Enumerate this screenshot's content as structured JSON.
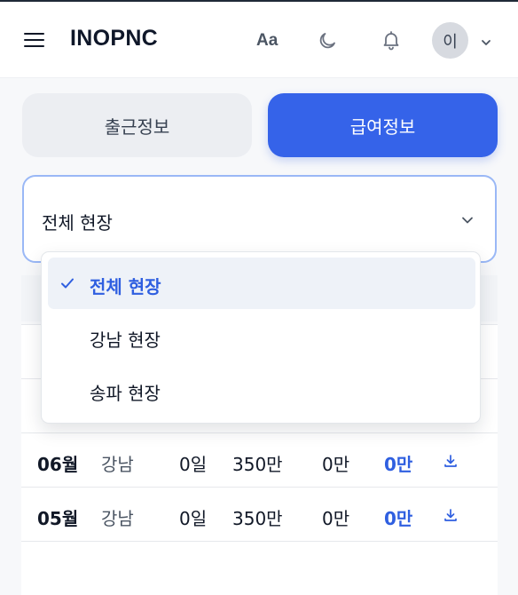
{
  "header": {
    "brand": "INOPNC",
    "font_size_label": "Aa",
    "avatar_initial": "이"
  },
  "tabs": [
    {
      "label": "출근정보",
      "active": false
    },
    {
      "label": "급여정보",
      "active": true
    }
  ],
  "site_select": {
    "value": "전체 현장",
    "options": [
      {
        "label": "전체 현장",
        "selected": true
      },
      {
        "label": "강남 현장",
        "selected": false
      },
      {
        "label": "송파 현장",
        "selected": false
      }
    ]
  },
  "salary_table": {
    "rows": [
      {
        "month": "06월",
        "site": "강남",
        "days": "0일",
        "base": "350만",
        "deduction": "0만",
        "net": "0만"
      },
      {
        "month": "05월",
        "site": "강남",
        "days": "0일",
        "base": "350만",
        "deduction": "0만",
        "net": "0만"
      }
    ]
  },
  "colors": {
    "accent": "#3563e9",
    "selected_text": "#2f5fe0",
    "select_border": "#9ab8f6"
  },
  "icons": [
    "menu-icon",
    "moon-icon",
    "bell-icon",
    "chevron-down-icon",
    "check-icon",
    "download-icon"
  ]
}
